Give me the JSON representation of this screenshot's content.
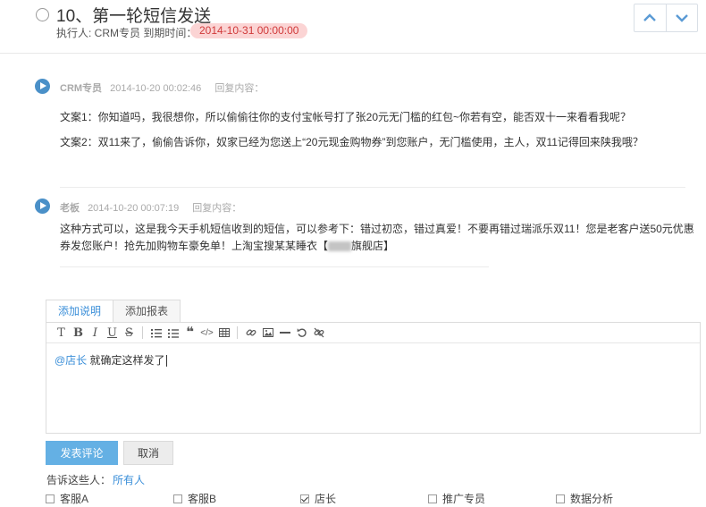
{
  "task": {
    "title": "10、第一轮短信发送",
    "meta": "执行人: CRM专员  到期时间：",
    "deadline": "2014-10-31 00:00:00"
  },
  "comments": [
    {
      "author": "CRM专员",
      "time": "2014-10-20 00:02:46",
      "reply_label": "回复内容：",
      "lines": [
        "文案1：你知道吗，我很想你，所以偷偷往你的支付宝帐号打了张20元无门槛的红包~你若有空，能否双十一来看看我呢？",
        "文案2：双11来了，偷偷告诉你，奴家已经为您送上“20元现金购物券”到您账户，无门槛使用，主人，双11记得回来陕我哦？"
      ]
    },
    {
      "author": "老板",
      "time": "2014-10-20 00:07:19",
      "reply_label": "回复内容：",
      "line1": "这种方式可以，这是我今天手机短信收到的短信，可以参考下：错过初恋，错过真爱！不要再错过瑞派乐双11！您是老客户送50元优惠",
      "line2_before": "券发您账户！抢先加购物车豪免单！上淘宝搜某某睡衣【",
      "line2_after": "旗舰店】"
    }
  ],
  "editor": {
    "tabs": [
      "添加说明",
      "添加报表"
    ],
    "mention": "@店长",
    "content": " 就确定这样发了",
    "toolbar_icons": [
      "bold-T-icon",
      "bold-icon",
      "italic-icon",
      "underline-icon",
      "strikethrough-icon",
      "ordered-list-icon",
      "unordered-list-icon",
      "quote-icon",
      "code-icon",
      "table-icon",
      "link-icon",
      "image-icon",
      "horizontal-rule-icon",
      "undo-icon",
      "unlink-icon"
    ]
  },
  "actions": {
    "submit": "发表评论",
    "cancel": "取消"
  },
  "notify": {
    "label": "告诉这些人：",
    "all_link": "所有人",
    "people": [
      {
        "name": "客服A",
        "checked": false
      },
      {
        "name": "客服B",
        "checked": false
      },
      {
        "name": "店长",
        "checked": true
      },
      {
        "name": "推广专员",
        "checked": false
      },
      {
        "name": "数据分析",
        "checked": false
      }
    ]
  },
  "colors": {
    "accent": "#3b8fd9",
    "submit_bg": "#64b0e4",
    "deadline_bg": "#fbd4d4",
    "deadline_text": "#d03a3a",
    "play_icon": "#4a90c8"
  }
}
